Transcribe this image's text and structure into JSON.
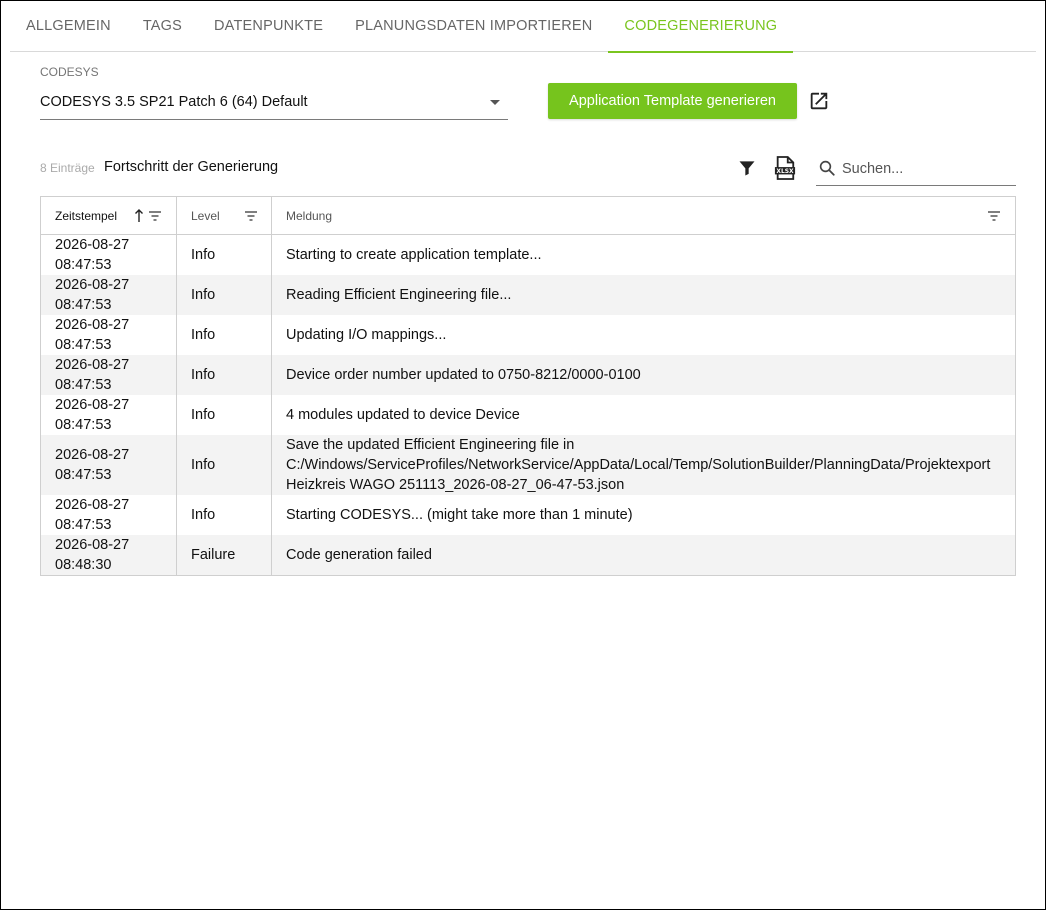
{
  "tabs": [
    {
      "label": "ALLGEMEIN",
      "active": false
    },
    {
      "label": "TAGS",
      "active": false
    },
    {
      "label": "DATENPUNKTE",
      "active": false
    },
    {
      "label": "PLANUNGSDATEN IMPORTIEREN",
      "active": false
    },
    {
      "label": "CODEGENERIERUNG",
      "active": true
    }
  ],
  "codesys": {
    "label": "CODESYS",
    "selected": "CODESYS 3.5 SP21 Patch 6 (64) Default"
  },
  "generate_button": "Application Template generieren",
  "toolbar": {
    "count": "8 Einträge",
    "title": "Fortschritt der Generierung",
    "search_placeholder": "Suchen..."
  },
  "table": {
    "columns": {
      "timestamp": "Zeitstempel",
      "level": "Level",
      "message": "Meldung"
    },
    "sort": {
      "column": "timestamp",
      "direction": "ascending"
    },
    "rows": [
      {
        "date": "2026-08-27",
        "time": "08:47:53",
        "level": "Info",
        "message": "Starting to create application template..."
      },
      {
        "date": "2026-08-27",
        "time": "08:47:53",
        "level": "Info",
        "message": "Reading Efficient Engineering file..."
      },
      {
        "date": "2026-08-27",
        "time": "08:47:53",
        "level": "Info",
        "message": "Updating I/O mappings..."
      },
      {
        "date": "2026-08-27",
        "time": "08:47:53",
        "level": "Info",
        "message": "Device order number updated to 0750-8212/0000-0100"
      },
      {
        "date": "2026-08-27",
        "time": "08:47:53",
        "level": "Info",
        "message": "4 modules updated to device Device"
      },
      {
        "date": "2026-08-27",
        "time": "08:47:53",
        "level": "Info",
        "message": "Save the updated Efficient Engineering file in C:/Windows/ServiceProfiles/NetworkService/AppData/Local/Temp/SolutionBuilder/PlanningData/Projektexport Heizkreis WAGO 251113_2026-08-27_06-47-53.json"
      },
      {
        "date": "2026-08-27",
        "time": "08:47:53",
        "level": "Info",
        "message": "Starting CODESYS... (might take more than 1 minute)"
      },
      {
        "date": "2026-08-27",
        "time": "08:48:30",
        "level": "Failure",
        "message": "Code generation failed"
      }
    ]
  },
  "colors": {
    "accent": "#76c41d",
    "tab_active": "#7ac51f",
    "row_alt": "#f3f3f3"
  }
}
